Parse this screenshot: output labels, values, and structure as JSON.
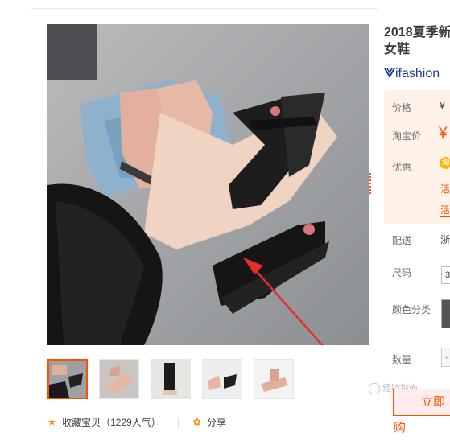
{
  "product": {
    "title_line1": "2018夏季新",
    "title_line2": "女鞋",
    "brand": "ifashion"
  },
  "price": {
    "price_label": "价格",
    "price_value": "¥",
    "taobao_label": "淘宝价",
    "taobao_value": "¥",
    "promo_label": "优惠",
    "promo_badge": "淘",
    "promo_tag1": "活",
    "promo_tag2": "活"
  },
  "shipping": {
    "label": "配送",
    "value": "浙"
  },
  "options": {
    "size_label": "尺码",
    "size_value": "3",
    "color_label": "颜色分类",
    "qty_label": "数量",
    "qty_value": "-"
  },
  "actions": {
    "buy_label": "立即购",
    "favorite_label": "收藏宝贝（1229人气）",
    "share_label": "分享"
  },
  "watermark": "经验指南"
}
